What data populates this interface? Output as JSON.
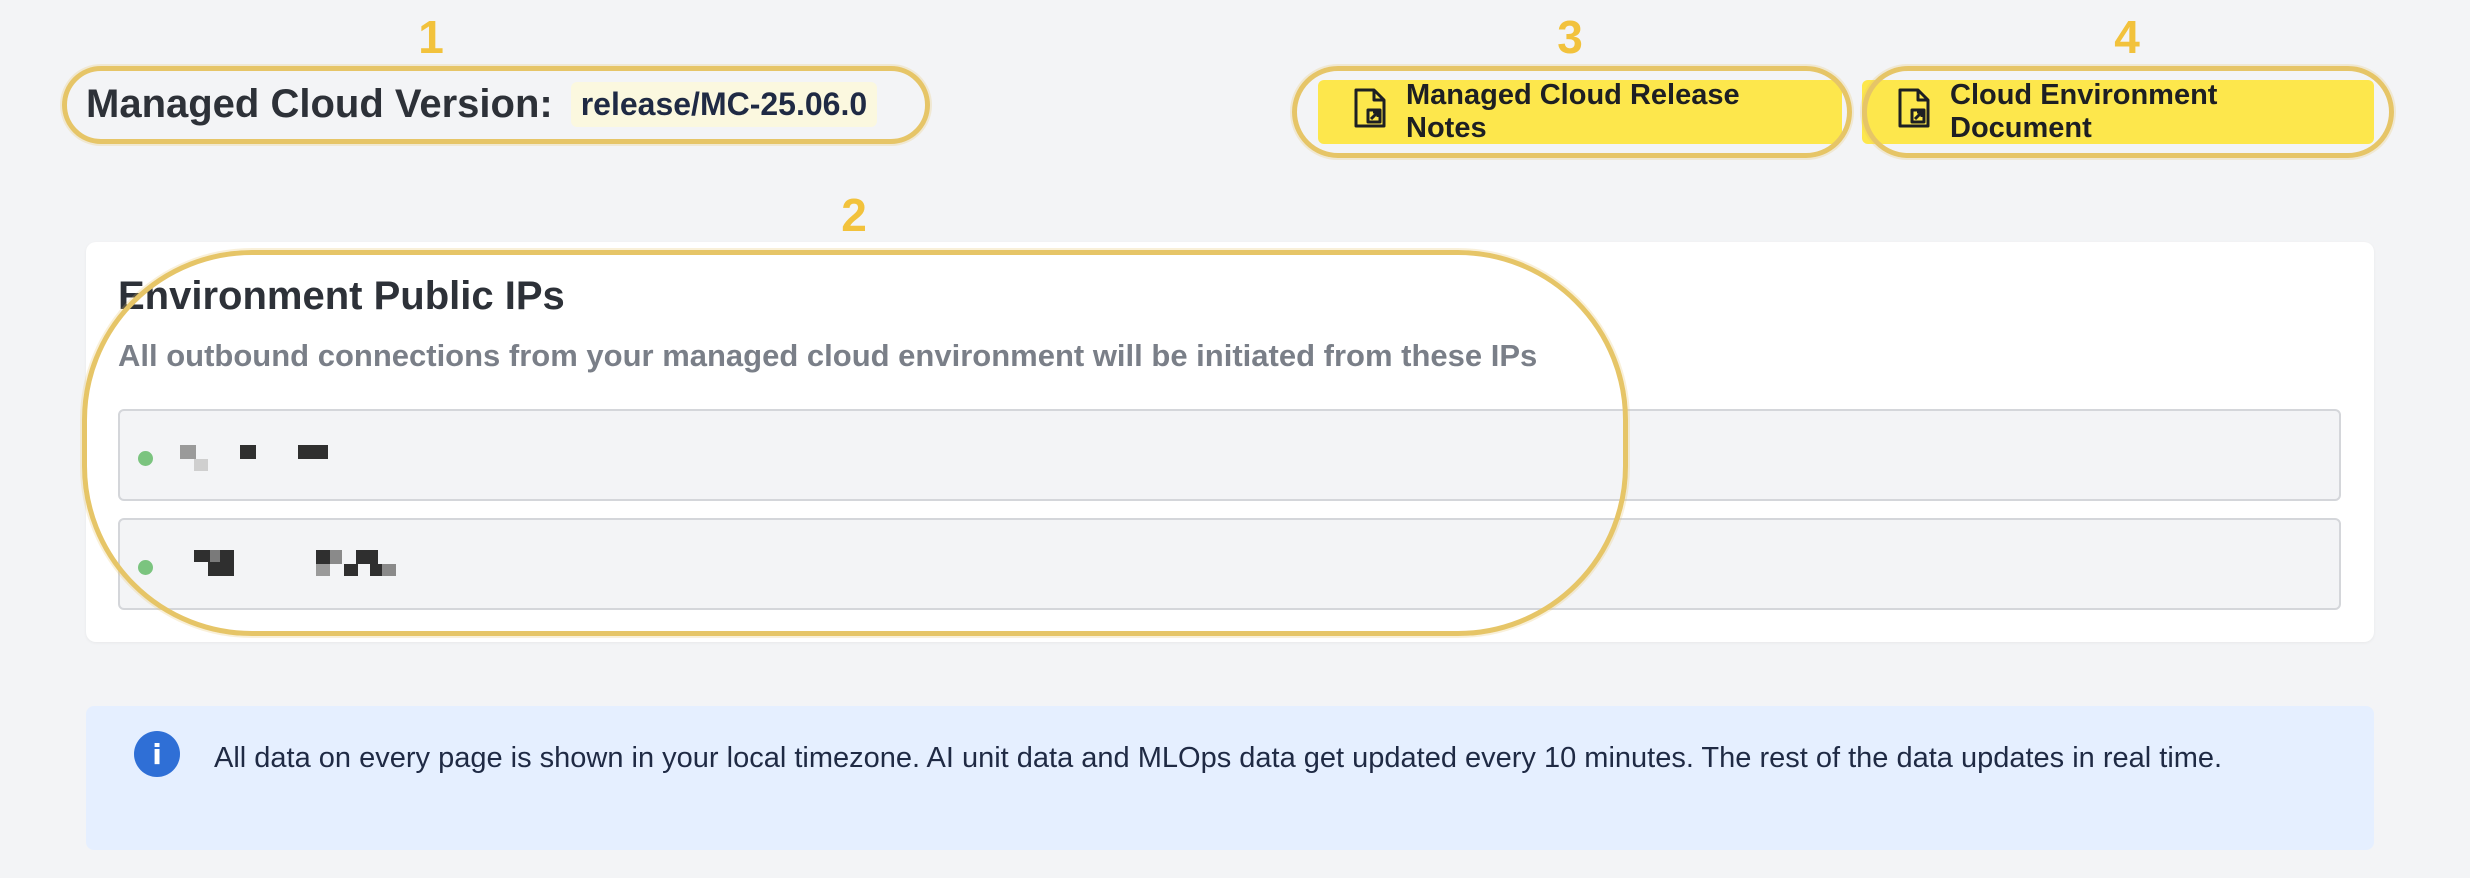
{
  "annotations": [
    "1",
    "2",
    "3",
    "4"
  ],
  "header": {
    "version_label": "Managed Cloud Version:",
    "version_value": "release/MC-25.06.0",
    "buttons": [
      {
        "label": "Managed Cloud Release Notes",
        "icon": "external-document-icon"
      },
      {
        "label": "Cloud Environment Document",
        "icon": "external-document-icon"
      }
    ]
  },
  "ips_card": {
    "title": "Environment Public IPs",
    "subtitle": "All outbound connections from your managed cloud environment will be initiated from these IPs",
    "status_color": "#7bc47f"
  },
  "info_banner": {
    "icon": "info-icon",
    "icon_glyph": "i",
    "text": "All data on every page is shown in your local timezone. AI unit data and MLOps data get updated every 10 minutes. The rest of the data updates in real time."
  },
  "colors": {
    "button_yellow": "#fde74c",
    "annotation": "#f2c23c",
    "info_background": "#e5efff",
    "info_icon": "#2f6fd6"
  }
}
